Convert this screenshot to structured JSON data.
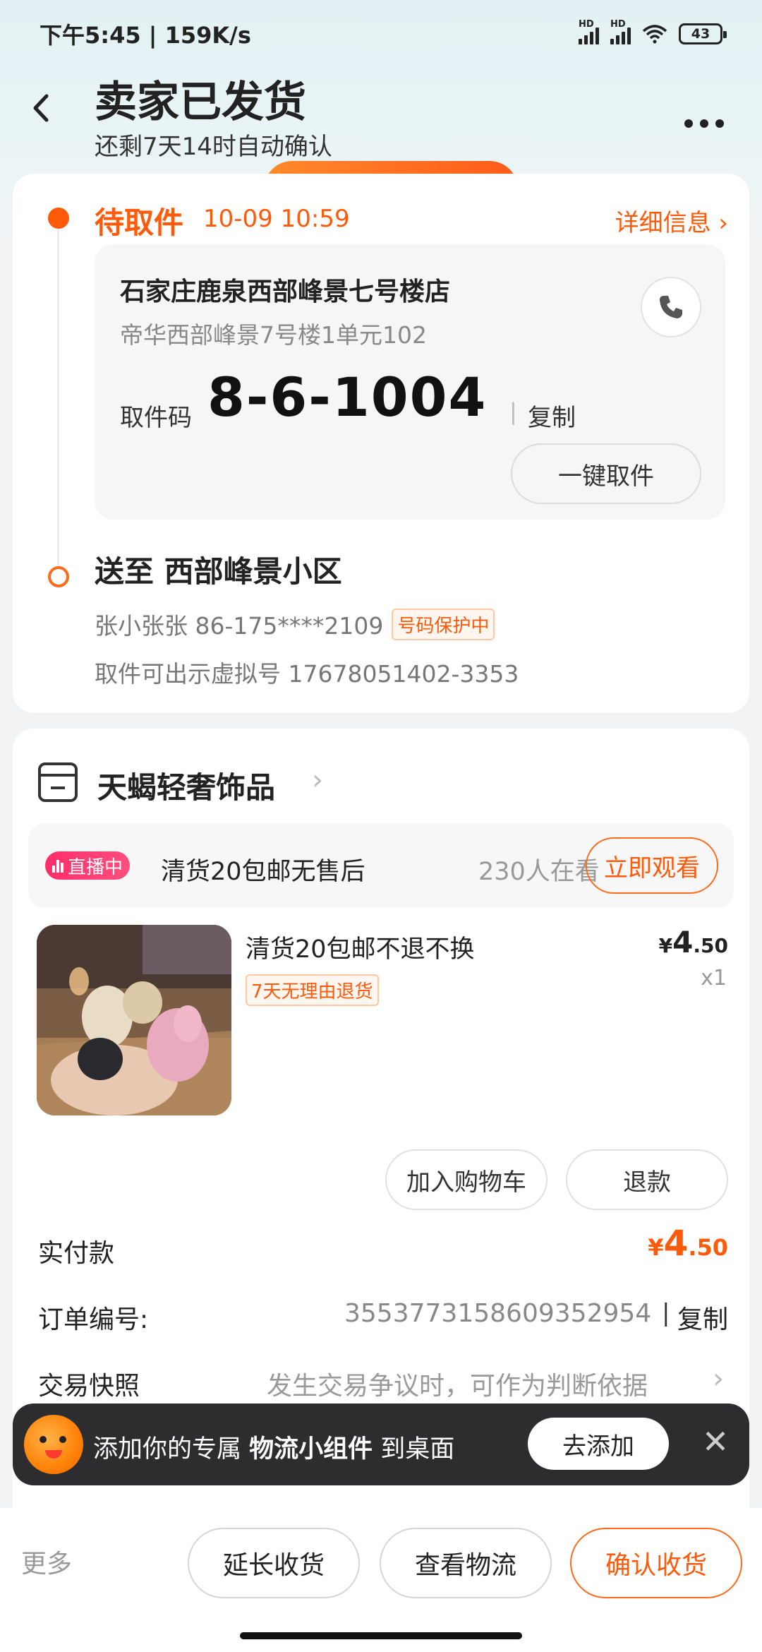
{
  "status_bar": {
    "time_speed": "下午5:45 | 159K/s",
    "signal_label": "HD",
    "battery": "43"
  },
  "header": {
    "title": "卖家已发货",
    "subtitle": "还剩7天14时自动确认",
    "back_icon": "chevron-left-icon",
    "more_icon": "more-dots-icon"
  },
  "pickup": {
    "status": "待取件",
    "time": "10-09 10:59",
    "detail_link": "详细信息 ›",
    "store_name": "石家庄鹿泉西部峰景七号楼店",
    "store_address": "帝华西部峰景7号楼1单元102",
    "code_label": "取件码",
    "code": "8-6-1004",
    "code_sep": "|",
    "copy": "复制",
    "one_click": "一键取件"
  },
  "delivery": {
    "title": "送至 西部峰景小区",
    "recipient": "张小张张 86-175****2109",
    "protect_badge": "号码保护中",
    "virtual_number": "取件可出示虚拟号 17678051402-3353"
  },
  "order": {
    "shop_name": "天蝎轻奢饰品",
    "shop_arrow": "›",
    "live_badge": "直播中",
    "live_text": "清货20包邮无售后",
    "live_viewers": "230人在看",
    "watch_button": "立即观看",
    "product_title": "清货20包邮不退不换",
    "product_tag": "7天无理由退货",
    "price_symbol": "¥",
    "price_int": "4",
    "price_dec": ".50",
    "qty": "x1",
    "add_cart": "加入购物车",
    "refund": "退款",
    "paid_label": "实付款",
    "paid_symbol": "¥",
    "paid_int": "4",
    "paid_dec": ".50",
    "order_label": "订单编号:",
    "order_number": "3553773158609352954",
    "order_sep": "|",
    "order_copy": "复制",
    "snapshot_label": "交易快照",
    "snapshot_hint": "发生交易争议时，可作为判断依据",
    "snapshot_arrow": "›"
  },
  "promo": {
    "text_prefix": "添加你的专属 ",
    "text_bold": "物流小组件",
    "text_suffix": " 到桌面",
    "add_button": "去添加",
    "close": "✕"
  },
  "bottom": {
    "more": "更多",
    "extend": "延长收货",
    "logistics": "查看物流",
    "confirm": "确认收货"
  },
  "colors": {
    "accent": "#ff5a0a",
    "live_pink": "#ff2d6a",
    "background": "#f2f3f5"
  }
}
